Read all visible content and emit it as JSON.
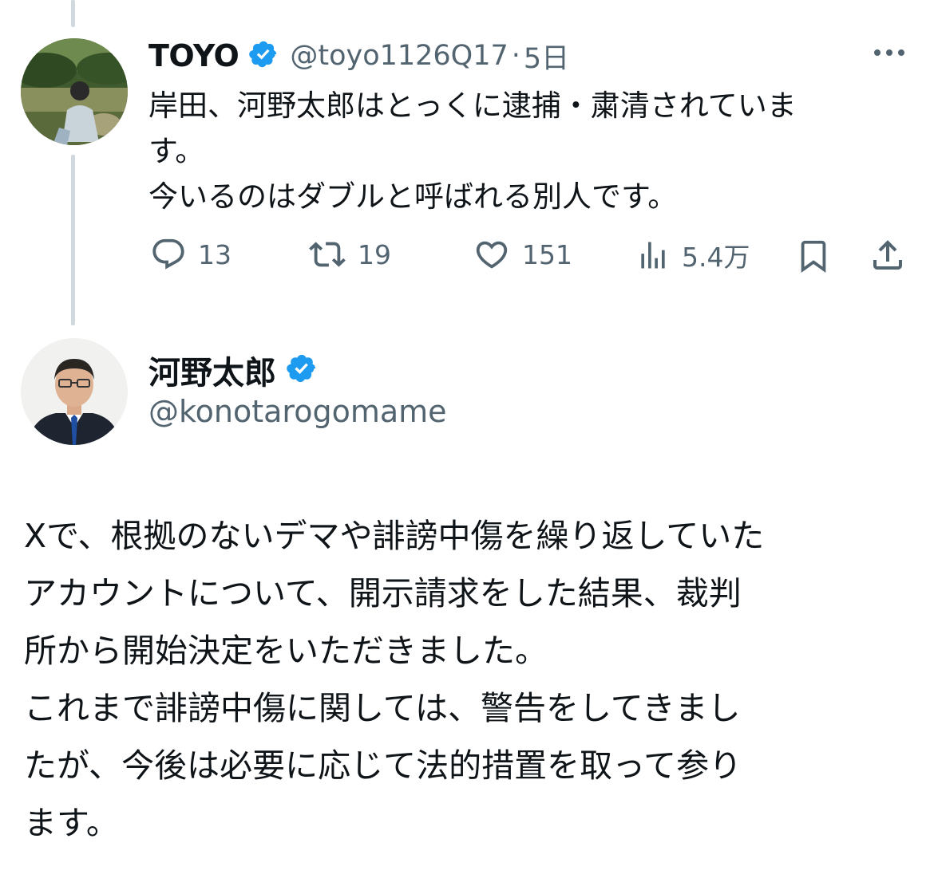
{
  "parent_tweet": {
    "display_name": "TOYO",
    "verified": true,
    "handle": "@toyo1126Q17",
    "separator": "·",
    "timestamp": "5日",
    "text_lines": [
      "岸田、河野太郎はとっくに逮捕・粛清されていま",
      "す。",
      "今いるのはダブルと呼ばれる別人です。"
    ],
    "actions": {
      "reply_count": "13",
      "retweet_count": "19",
      "like_count": "151",
      "view_count": "5.4万"
    }
  },
  "main_tweet": {
    "display_name": "河野太郎",
    "verified": true,
    "handle": "@konotarogomame",
    "text_lines": [
      "Xで、根拠のないデマや誹謗中傷を繰り返していた",
      "アカウントについて、開示請求をした結果、裁判",
      "所から開始決定をいただきました。",
      "これまで誹謗中傷に関しては、警告をしてきまし",
      "たが、今後は必要に応じて法的措置を取って参り",
      "ます。"
    ]
  },
  "colors": {
    "verified_badge": "#1d9bf0",
    "secondary_text": "#536471",
    "thread_line": "#cfd9de",
    "primary_text": "#0f1419"
  },
  "icons": [
    "more-icon",
    "verified-badge-icon",
    "reply-icon",
    "retweet-icon",
    "like-icon",
    "views-icon",
    "bookmark-icon",
    "share-icon"
  ]
}
